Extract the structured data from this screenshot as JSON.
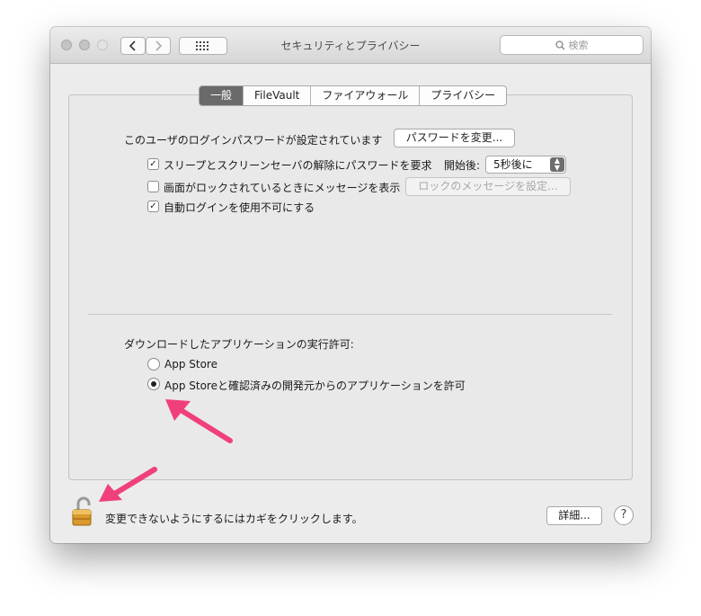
{
  "window": {
    "title": "セキュリティとプライバシー",
    "search_placeholder": "検索"
  },
  "tabs": [
    {
      "label": "一般",
      "active": true
    },
    {
      "label": "FileVault",
      "active": false
    },
    {
      "label": "ファイアウォール",
      "active": false
    },
    {
      "label": "プライバシー",
      "active": false
    }
  ],
  "general": {
    "password_set_text": "このユーザのログインパスワードが設定されています",
    "change_password_button": "パスワードを変更...",
    "require_password": {
      "label": "スリープとスクリーンセーバの解除にパスワードを要求",
      "checked": true
    },
    "start_after_label": "開始後:",
    "start_after_value": "5秒後に",
    "lock_message": {
      "label": "画面がロックされているときにメッセージを表示",
      "checked": false
    },
    "set_lock_message_button": "ロックのメッセージを設定...",
    "disable_autologin": {
      "label": "自動ログインを使用不可にする",
      "checked": true
    }
  },
  "downloads": {
    "heading": "ダウンロードしたアプリケーションの実行許可:",
    "options": [
      {
        "label": "App Store",
        "selected": false
      },
      {
        "label": "App Storeと確認済みの開発元からのアプリケーションを許可",
        "selected": true
      }
    ]
  },
  "footer": {
    "lock_text": "変更できないようにするにはカギをクリックします。",
    "advanced_button": "詳細...",
    "help_label": "?"
  },
  "annotation_color": "#f0407a"
}
